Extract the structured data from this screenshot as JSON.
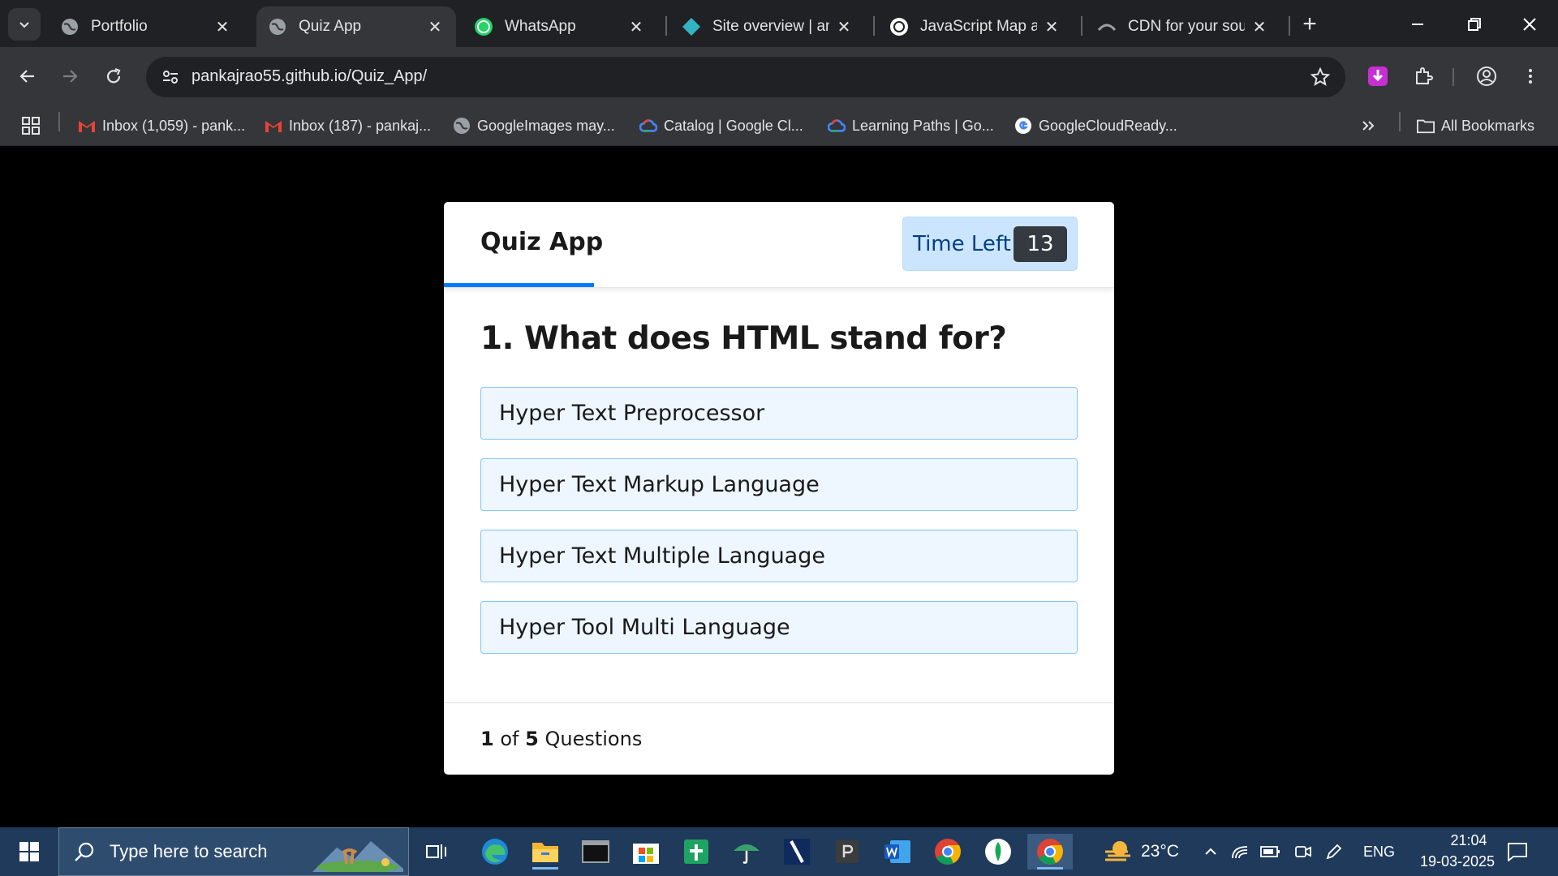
{
  "browser": {
    "tabs": [
      {
        "title": "Portfolio",
        "icon": "globe-icon",
        "active": false
      },
      {
        "title": "Quiz App",
        "icon": "globe-icon",
        "active": true
      },
      {
        "title": "WhatsApp",
        "icon": "whatsapp-icon",
        "active": false
      },
      {
        "title": "Site overview | anir",
        "icon": "netlify-icon",
        "active": false
      },
      {
        "title": "JavaScript Map and",
        "icon": "openai-icon",
        "active": false
      },
      {
        "title": "CDN for your sourc",
        "icon": "cdn-icon",
        "active": false
      }
    ],
    "url": "pankajrao55.github.io/Quiz_App/",
    "bookmarks": [
      {
        "label": "Inbox (1,059) - pank...",
        "icon": "gmail-icon"
      },
      {
        "label": "Inbox (187) - pankaj...",
        "icon": "gmail-icon"
      },
      {
        "label": "GoogleImages may...",
        "icon": "globe-icon"
      },
      {
        "label": "Catalog | Google Cl...",
        "icon": "google-cloud-icon"
      },
      {
        "label": "Learning Paths | Go...",
        "icon": "google-cloud-icon"
      },
      {
        "label": "GoogleCloudReady...",
        "icon": "google-icon"
      }
    ],
    "all_bookmarks_label": "All Bookmarks"
  },
  "quiz": {
    "title": "Quiz App",
    "timer_label": "Time Left",
    "timer_value": "13",
    "question": "1. What does HTML stand for?",
    "options": [
      "Hyper Text Preprocessor",
      "Hyper Text Markup Language",
      "Hyper Text Multiple Language",
      "Hyper Tool Multi Language"
    ],
    "footer": {
      "current": "1",
      "of": "of",
      "total": "5",
      "suffix": "Questions"
    },
    "colors": {
      "accent": "#007bff",
      "timer_bg": "#cce5ff",
      "option_bg": "#eef6ff",
      "option_border": "#84c5fe"
    }
  },
  "taskbar": {
    "search_placeholder": "Type here to search",
    "weather": "23°C",
    "language": "ENG",
    "time": "21:04",
    "date": "19-03-2025"
  }
}
